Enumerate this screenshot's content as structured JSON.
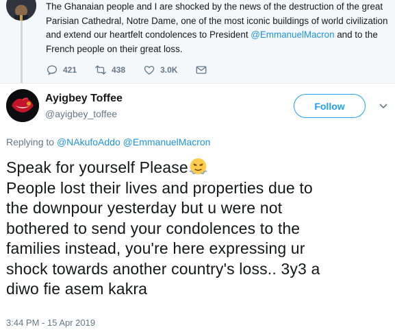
{
  "parent_tweet": {
    "text_part1": "The Ghanaian people and I are shocked by the news of the destruction of the great Parisian Cathedral, Notre Dame, one of the most iconic buildings of world civilization and extend our heartfelt condolences to President ",
    "mention": "@EmmanuelMacron",
    "text_part2": " and to the French people on their great loss.",
    "replies": "421",
    "retweets": "438",
    "likes": "3.0K"
  },
  "reply_tweet": {
    "display_name": "Ayigbey Toffee",
    "handle": "@ayigbey_toffee",
    "follow_label": "Follow",
    "replying_prefix": "Replying to ",
    "replying_to": [
      "@NAkufoAddo",
      "@EmmanuelMacron"
    ],
    "lines": [
      "Speak for yourself Please",
      "People lost their lives and properties due to",
      "the downpour yesterday but u were not",
      "bothered to send your condolences to the",
      "families  instead, you're here expressing ur",
      "shock towards another country's loss.. 3y3 a",
      "diwo fie asem kakra"
    ],
    "emoji": "face-with-steam-from-nose-icon",
    "timestamp": "3:44 PM - 15 Apr 2019"
  },
  "colors": {
    "link": "#1b95e0",
    "follow": "#1da1f2",
    "muted": "#657786",
    "parent_bg": "#f5f8fa"
  }
}
